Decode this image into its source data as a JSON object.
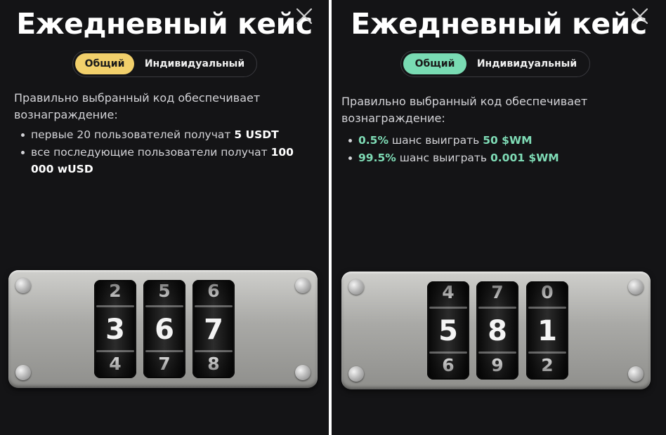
{
  "left": {
    "title": "Ежедневный кейс",
    "tabs": [
      {
        "label": "Общий",
        "active": true
      },
      {
        "label": "Индивидуальный",
        "active": false
      }
    ],
    "description": "Правильно выбранный код обеспечивает вознаграждение:",
    "rewards": [
      {
        "text": "первые 20 пользователей получат ",
        "bold": "5 USDT"
      },
      {
        "text": "все последующие пользователи получат ",
        "bold": "100 000 wUSD"
      }
    ],
    "lock": [
      {
        "top": "2",
        "mid": "3",
        "bot": "4"
      },
      {
        "top": "5",
        "mid": "6",
        "bot": "7"
      },
      {
        "top": "6",
        "mid": "7",
        "bot": "8"
      }
    ],
    "accent": "#f2d06b"
  },
  "right": {
    "title": "Ежедневный кейс",
    "tabs": [
      {
        "label": "Общий",
        "active": true
      },
      {
        "label": "Индивидуальный",
        "active": false
      }
    ],
    "description": "Правильно выбранный код обеспечивает вознаграждение:",
    "rewards": [
      {
        "pct": "0.5%",
        "text": " шанс выиграть ",
        "bold": "50 $WM"
      },
      {
        "pct": "99.5%",
        "text": " шанс выиграть ",
        "bold": "0.001 $WM"
      }
    ],
    "lock": [
      {
        "top": "4",
        "mid": "5",
        "bot": "6"
      },
      {
        "top": "7",
        "mid": "8",
        "bot": "9"
      },
      {
        "top": "0",
        "mid": "1",
        "bot": "2"
      }
    ],
    "accent": "#79dbb3"
  },
  "icons": [
    "close-icon"
  ]
}
